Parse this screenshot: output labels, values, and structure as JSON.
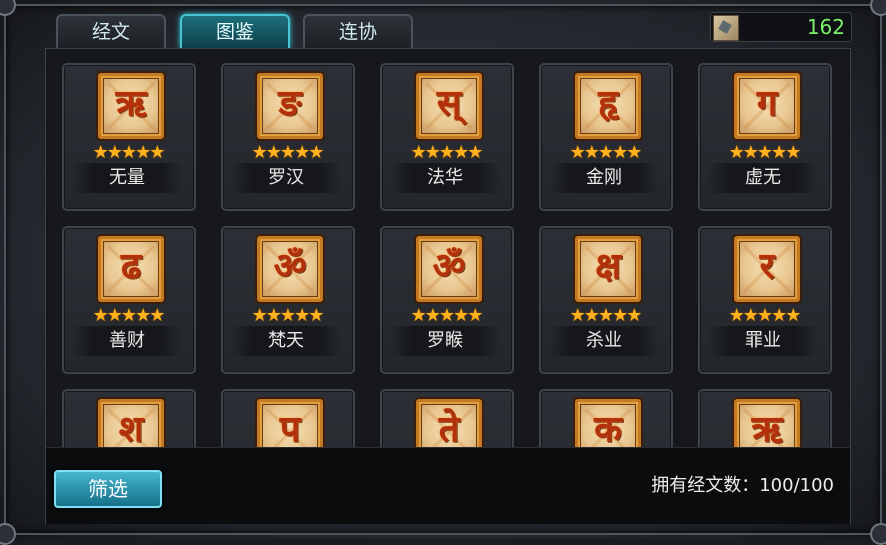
{
  "tabs": [
    {
      "label": "经文",
      "active": false
    },
    {
      "label": "图鉴",
      "active": true
    },
    {
      "label": "连协",
      "active": false
    }
  ],
  "resource": {
    "icon": "scroll-map-icon",
    "value": "162"
  },
  "cards": [
    {
      "name": "无量",
      "glyph": "ऋ",
      "stars": 5
    },
    {
      "name": "罗汉",
      "glyph": "ङ",
      "stars": 5
    },
    {
      "name": "法华",
      "glyph": "स्",
      "stars": 5
    },
    {
      "name": "金刚",
      "glyph": "हृ",
      "stars": 5
    },
    {
      "name": "虚无",
      "glyph": "ग",
      "stars": 5
    },
    {
      "name": "善财",
      "glyph": "ढ",
      "stars": 5
    },
    {
      "name": "梵天",
      "glyph": "ॐ",
      "stars": 5
    },
    {
      "name": "罗睺",
      "glyph": "ॐ",
      "stars": 5
    },
    {
      "name": "杀业",
      "glyph": "क्ष",
      "stars": 5
    },
    {
      "name": "罪业",
      "glyph": "र",
      "stars": 5
    },
    {
      "name": "",
      "glyph": "श",
      "stars": 0
    },
    {
      "name": "",
      "glyph": "प",
      "stars": 0
    },
    {
      "name": "",
      "glyph": "ते",
      "stars": 0
    },
    {
      "name": "",
      "glyph": "क",
      "stars": 0
    },
    {
      "name": "",
      "glyph": "ऋ",
      "stars": 0
    }
  ],
  "bottom": {
    "filter_label": "筛选",
    "count_text": "拥有经文数：100/100"
  },
  "colors": {
    "accent": "#49c4d4",
    "star": "#ffb21e",
    "resource": "#7cf26a"
  }
}
